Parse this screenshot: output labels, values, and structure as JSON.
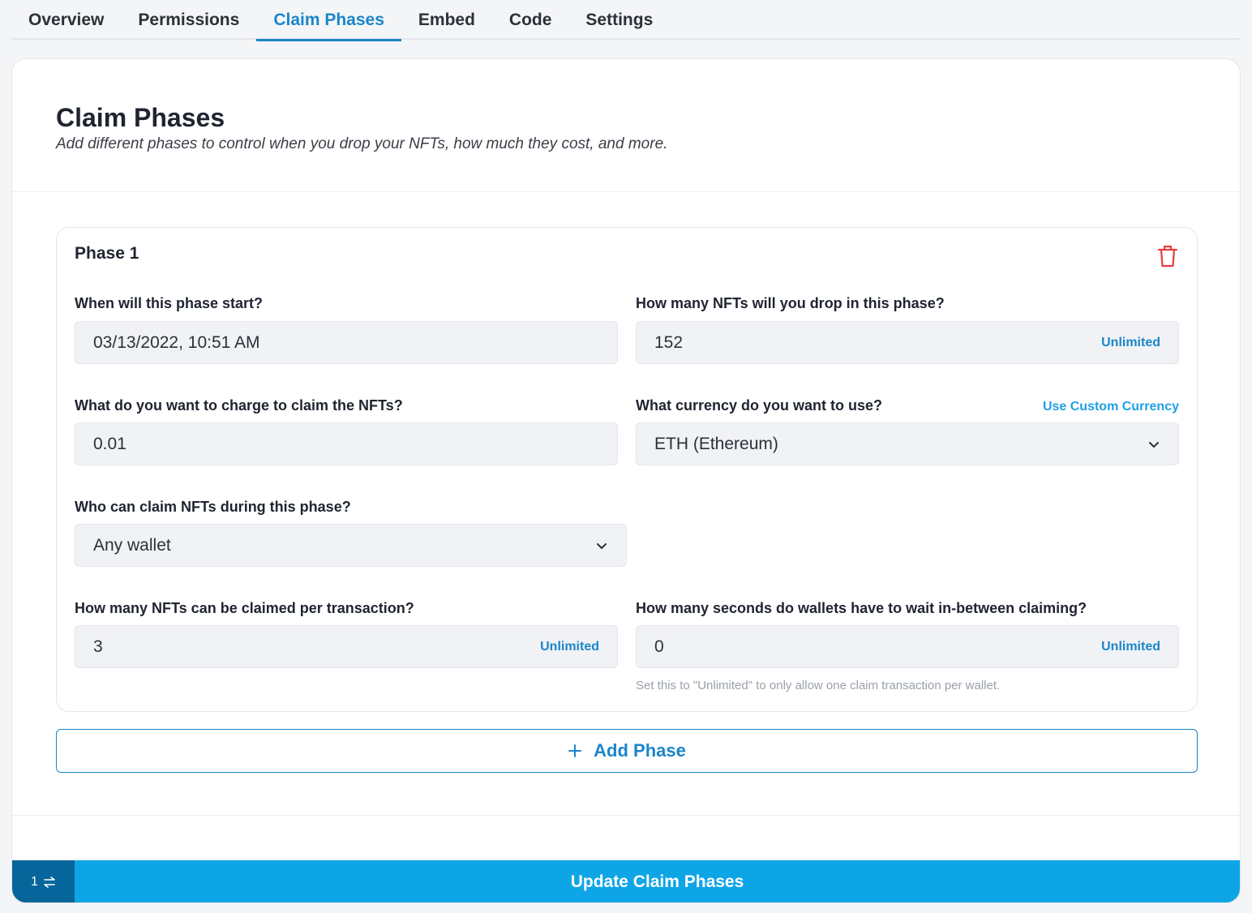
{
  "tabs": [
    {
      "label": "Overview",
      "active": false
    },
    {
      "label": "Permissions",
      "active": false
    },
    {
      "label": "Claim Phases",
      "active": true
    },
    {
      "label": "Embed",
      "active": false
    },
    {
      "label": "Code",
      "active": false
    },
    {
      "label": "Settings",
      "active": false
    }
  ],
  "header": {
    "title": "Claim Phases",
    "subtitle": "Add different phases to control when you drop your NFTs, how much they cost, and more."
  },
  "phase": {
    "title": "Phase 1",
    "start": {
      "label": "When will this phase start?",
      "value": "03/13/2022, 10:51 AM"
    },
    "supply": {
      "label": "How many NFTs will you drop in this phase?",
      "value": "152",
      "unlimited": "Unlimited"
    },
    "price": {
      "label": "What do you want to charge to claim the NFTs?",
      "value": "0.01"
    },
    "currency": {
      "label": "What currency do you want to use?",
      "value": "ETH (Ethereum)",
      "custom_link": "Use Custom Currency"
    },
    "who": {
      "label": "Who can claim NFTs during this phase?",
      "value": "Any wallet"
    },
    "per_tx": {
      "label": "How many NFTs can be claimed per transaction?",
      "value": "3",
      "unlimited": "Unlimited"
    },
    "wait": {
      "label": "How many seconds do wallets have to wait in-between claiming?",
      "value": "0",
      "unlimited": "Unlimited",
      "help": "Set this to \"Unlimited\" to only allow one claim transaction per wallet."
    }
  },
  "add_phase_label": "Add Phase",
  "footer": {
    "count": "1",
    "update_label": "Update Claim Phases"
  },
  "colors": {
    "accent": "#1a86c9",
    "primary_button": "#0ea5e6",
    "danger": "#e53e3e"
  }
}
